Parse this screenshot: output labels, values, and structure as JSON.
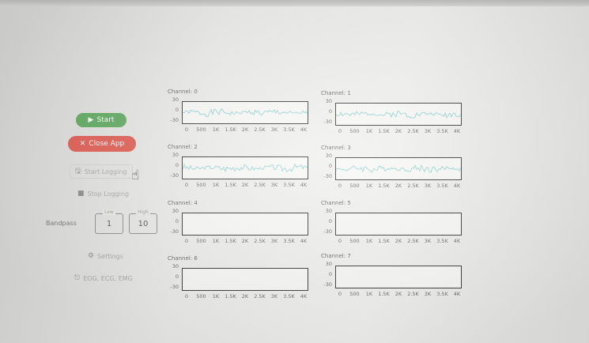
{
  "sidebar": {
    "start_label": "Start",
    "close_label": "Close App",
    "start_logging_label": "Start Logging",
    "stop_logging_label": "Stop Logging",
    "bandpass": {
      "label": "Bandpass",
      "low_caption": "Low",
      "low_value": "1",
      "high_caption": "High",
      "high_value": "10"
    },
    "settings_label": "Settings",
    "eeg_label": "EOG, ECG, EMG"
  },
  "colors": {
    "start_button": "#5fa960",
    "close_button": "#e05b51",
    "signal_trace": "#8fd0d0",
    "plot_border": "#333333"
  },
  "icons": {
    "start": "play-icon",
    "close": "close-icon",
    "start_logging": "floppy-disk-icon",
    "stop_logging": "stop-icon",
    "settings": "gear-icon",
    "eeg": "exit-icon",
    "cursor": "hand-pointer-icon"
  },
  "channels": [
    {
      "title": "Channel: 0",
      "has_signal": true
    },
    {
      "title": "Channel: 1",
      "has_signal": true
    },
    {
      "title": "Channel: 2",
      "has_signal": true
    },
    {
      "title": "Channel: 3",
      "has_signal": true
    },
    {
      "title": "Channel: 4",
      "has_signal": false
    },
    {
      "title": "Channel: 5",
      "has_signal": false
    },
    {
      "title": "Channel: 6",
      "has_signal": false
    },
    {
      "title": "Channel: 7",
      "has_signal": false
    }
  ],
  "chart_data": {
    "type": "line",
    "y_ticks": [
      "30",
      "0",
      "-30"
    ],
    "ylim": [
      -30,
      30
    ],
    "x_ticks": [
      "0",
      "500",
      "1K",
      "1.5K",
      "2K",
      "2.5K",
      "3K",
      "3.5K",
      "4K"
    ],
    "xlim": [
      0,
      4000
    ],
    "grid": false
  }
}
